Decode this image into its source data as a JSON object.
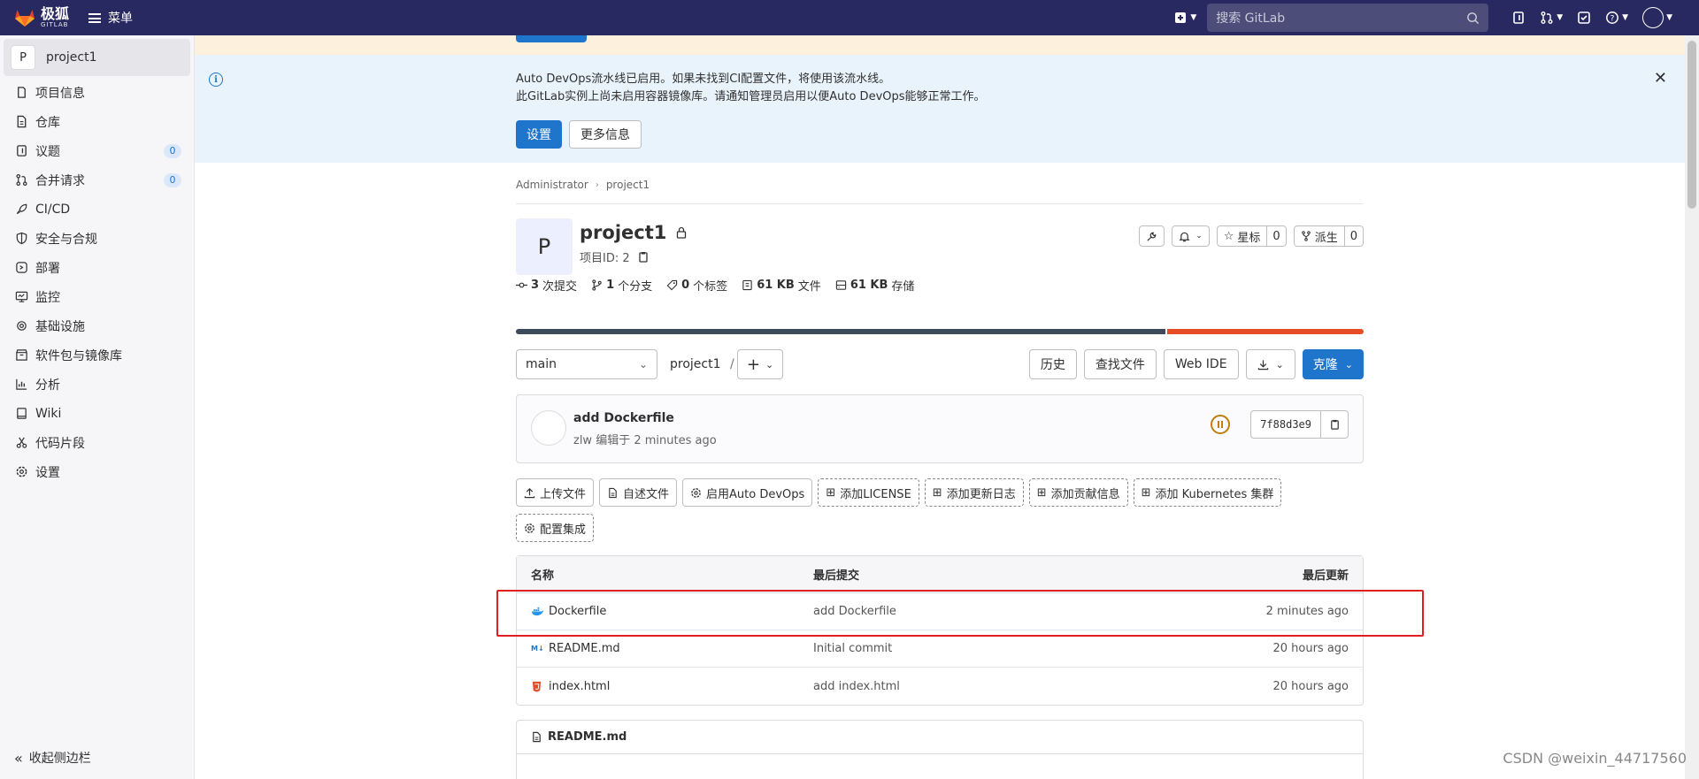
{
  "topbar": {
    "brand_cn": "极狐",
    "brand_en": "GITLAB",
    "menu_label": "菜单",
    "search_placeholder": "搜索 GitLab"
  },
  "sidebar": {
    "project_initial": "P",
    "project_name": "project1",
    "items": [
      {
        "label": "项目信息",
        "icon": "info-icon"
      },
      {
        "label": "仓库",
        "icon": "doc-icon"
      },
      {
        "label": "议题",
        "icon": "issues-icon",
        "badge": "0"
      },
      {
        "label": "合并请求",
        "icon": "merge-request-icon",
        "badge": "0"
      },
      {
        "label": "CI/CD",
        "icon": "rocket-icon"
      },
      {
        "label": "安全与合规",
        "icon": "shield-icon"
      },
      {
        "label": "部署",
        "icon": "deployments-icon"
      },
      {
        "label": "监控",
        "icon": "monitor-icon"
      },
      {
        "label": "基础设施",
        "icon": "cloud-gear-icon"
      },
      {
        "label": "软件包与镜像库",
        "icon": "package-icon"
      },
      {
        "label": "分析",
        "icon": "chart-icon"
      },
      {
        "label": "Wiki",
        "icon": "book-icon"
      },
      {
        "label": "代码片段",
        "icon": "scissors-icon"
      },
      {
        "label": "设置",
        "icon": "gear-icon"
      }
    ],
    "collapse_label": "收起侧边栏"
  },
  "banner": {
    "line1": "Auto DevOps流水线已启用。如果未找到CI配置文件，将使用该流水线。",
    "line2": "此GitLab实例上尚未启用容器镜像库。请通知管理员启用以便Auto DevOps能够正常工作。",
    "primary_button": "设置",
    "secondary_button": "更多信息"
  },
  "breadcrumb": {
    "parent": "Administrator",
    "current": "project1"
  },
  "project": {
    "initial": "P",
    "name": "project1",
    "id_label": "项目ID: 2",
    "star_label": "星标",
    "star_count": "0",
    "fork_label": "派生",
    "fork_count": "0"
  },
  "stats": {
    "commits_num": "3",
    "commits_label": "次提交",
    "branches_num": "1",
    "branches_label": "个分支",
    "tags_num": "0",
    "tags_label": "个标签",
    "files_size": "61 KB",
    "files_label": "文件",
    "storage_size": "61 KB",
    "storage_label": "存储"
  },
  "language_bar": [
    {
      "share": 0.768,
      "color": "#3d4a5a"
    },
    {
      "share": 0.232,
      "color": "#e44d26"
    }
  ],
  "toolbar": {
    "branch": "main",
    "path": "project1",
    "path_sep": "/",
    "history": "历史",
    "find_file": "查找文件",
    "web_ide": "Web IDE",
    "clone": "克隆"
  },
  "last_commit": {
    "message": "add Dockerfile",
    "meta": "zlw 编辑于 2 minutes ago",
    "sha": "7f88d3e9"
  },
  "quick_actions": [
    {
      "label": "上传文件",
      "dashed": false
    },
    {
      "label": "自述文件",
      "dashed": false
    },
    {
      "label": "启用Auto DevOps",
      "dashed": false
    },
    {
      "label": "添加LICENSE",
      "dashed": true
    },
    {
      "label": "添加更新日志",
      "dashed": true
    },
    {
      "label": "添加贡献信息",
      "dashed": true
    },
    {
      "label": "添加 Kubernetes 集群",
      "dashed": true
    },
    {
      "label": "配置集成",
      "dashed": true
    }
  ],
  "file_table": {
    "headers": [
      "名称",
      "最后提交",
      "最后更新"
    ],
    "rows": [
      {
        "name": "Dockerfile",
        "icon": "docker-icon",
        "commit": "add Dockerfile",
        "updated": "2 minutes ago"
      },
      {
        "name": "README.md",
        "icon": "markdown-icon",
        "commit": "Initial commit",
        "updated": "20 hours ago"
      },
      {
        "name": "index.html",
        "icon": "html5-icon",
        "commit": "add index.html",
        "updated": "20 hours ago"
      }
    ]
  },
  "readme_title": "README.md",
  "watermark": "CSDN @weixin_44717560"
}
